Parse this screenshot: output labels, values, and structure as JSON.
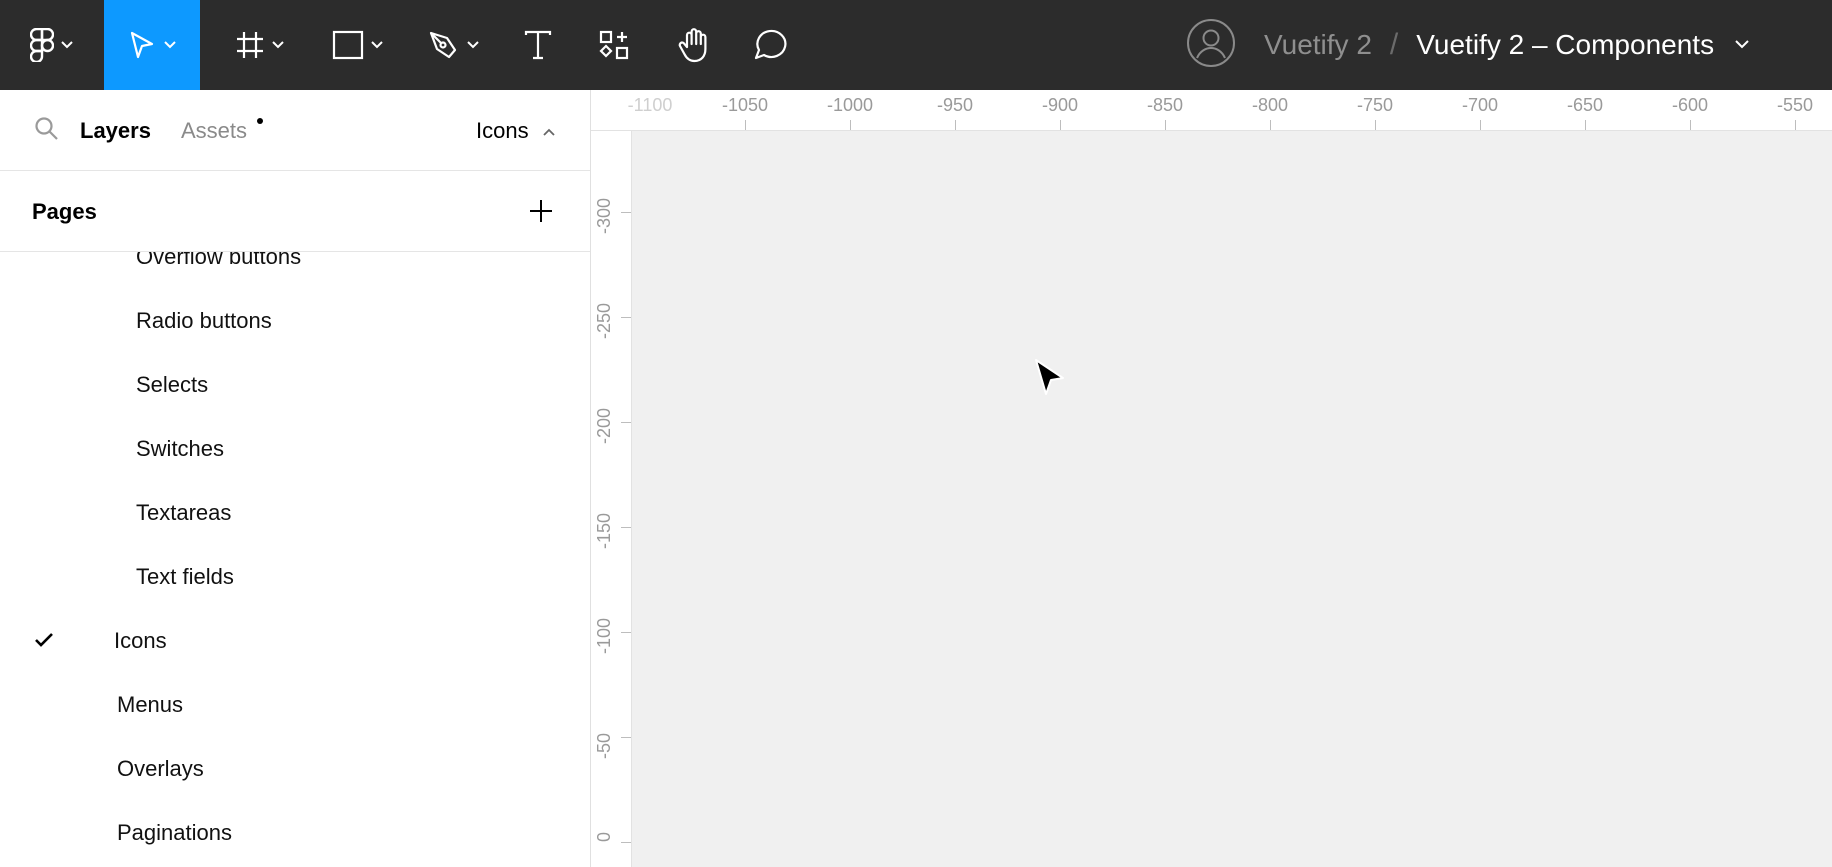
{
  "toolbar": {
    "breadcrumb": {
      "team": "Vuetify 2",
      "separator": "/",
      "file": "Vuetify 2 – Components"
    },
    "active_color": "#0d99ff",
    "background": "#2c2c2c",
    "tools": [
      {
        "name": "main-menu",
        "icon": "figma-logo-icon"
      },
      {
        "name": "move-tool",
        "icon": "cursor-arrow-icon",
        "active": true
      },
      {
        "name": "frame-tool",
        "icon": "frame-hash-icon"
      },
      {
        "name": "shape-tool",
        "icon": "rectangle-icon"
      },
      {
        "name": "pen-tool",
        "icon": "pen-icon"
      },
      {
        "name": "text-tool",
        "icon": "text-t-icon"
      },
      {
        "name": "resources-tool",
        "icon": "components-icon"
      },
      {
        "name": "hand-tool",
        "icon": "hand-icon"
      },
      {
        "name": "comment-tool",
        "icon": "comment-bubble-icon"
      }
    ]
  },
  "sidebar": {
    "tabs": {
      "layers": "Layers",
      "assets": "Assets",
      "current_page": "Icons"
    },
    "pages_header": "Pages",
    "pages": [
      {
        "label": "Overflow buttons",
        "indent": "sub",
        "checked": false
      },
      {
        "label": "Radio buttons",
        "indent": "sub",
        "checked": false
      },
      {
        "label": "Selects",
        "indent": "sub",
        "checked": false
      },
      {
        "label": "Switches",
        "indent": "sub",
        "checked": false
      },
      {
        "label": "Textareas",
        "indent": "sub",
        "checked": false
      },
      {
        "label": "Text fields",
        "indent": "sub",
        "checked": false
      },
      {
        "label": "Icons",
        "indent": "top",
        "checked": true
      },
      {
        "label": "Menus",
        "indent": "top",
        "checked": false
      },
      {
        "label": "Overlays",
        "indent": "top",
        "checked": false
      },
      {
        "label": "Paginations",
        "indent": "top",
        "checked": false
      }
    ]
  },
  "rulers": {
    "top": [
      "-1100",
      "-1050",
      "-1000",
      "-950",
      "-900",
      "-850",
      "-800",
      "-750",
      "-700",
      "-650",
      "-600",
      "-550"
    ],
    "left": [
      "-300",
      "-250",
      "-200",
      "-150",
      "-100",
      "-50",
      "0"
    ]
  },
  "canvas": {
    "background": "#f0f0f0"
  }
}
